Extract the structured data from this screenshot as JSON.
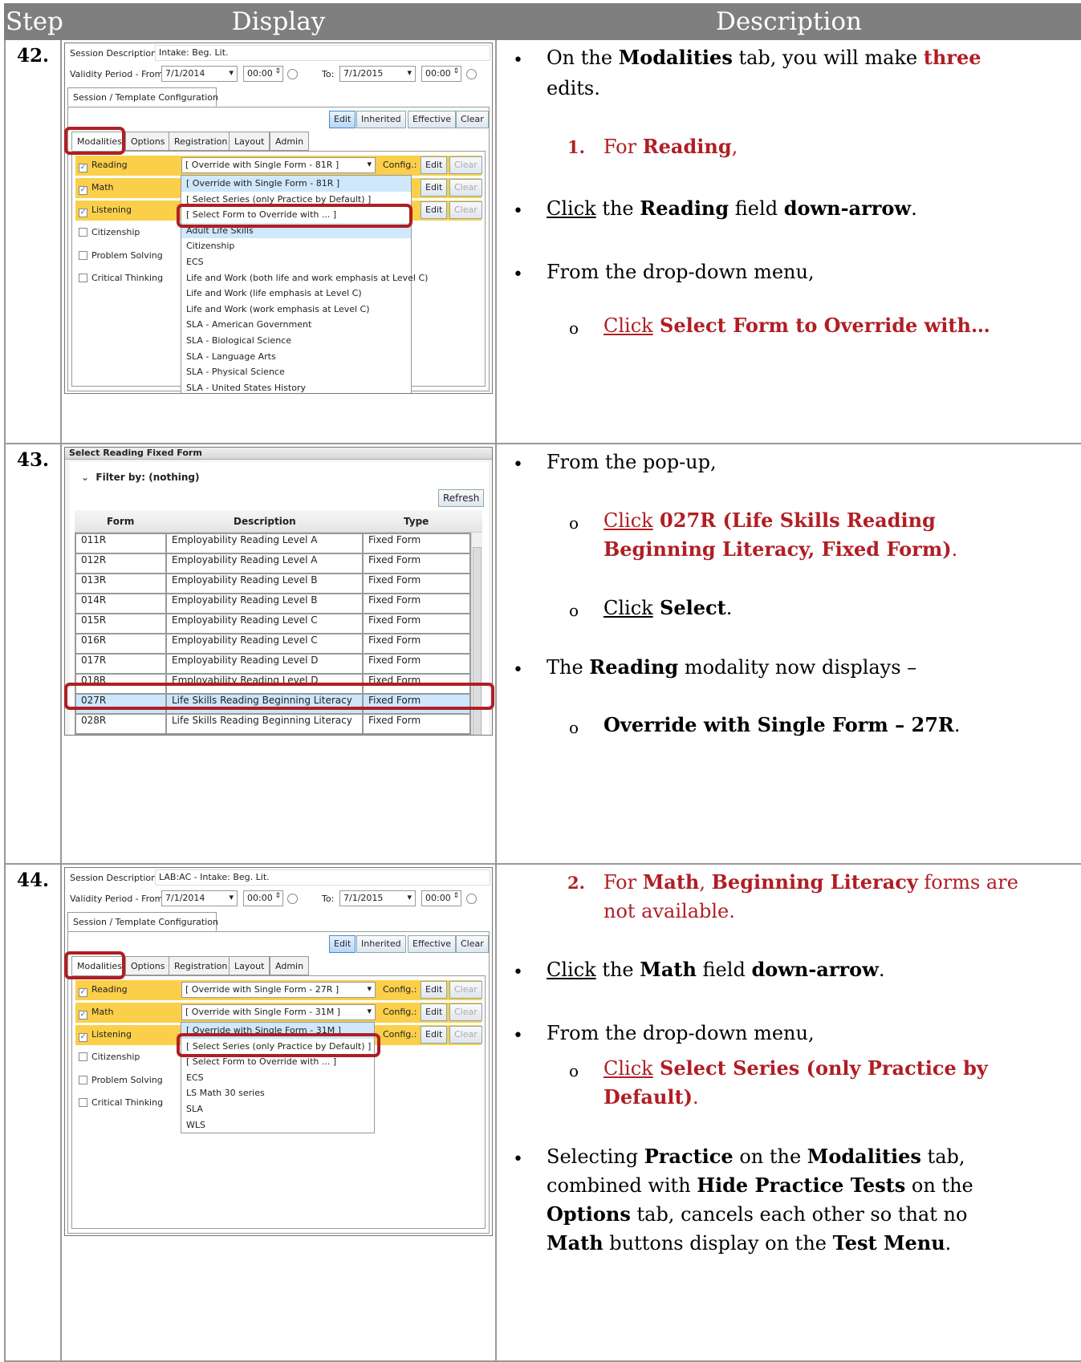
{
  "header": {
    "step": "Step",
    "display": "Display",
    "description": "Description"
  },
  "colors": {
    "accent_red": "#b01e24",
    "modality_yellow": "#fbcf4a",
    "header_gray": "#7f7f7f"
  },
  "rows": [
    {
      "step": "42.",
      "shot": {
        "session_label": "Session Description:",
        "session_value": "Intake: Beg. Lit.",
        "validity_from_label": "Validity Period - From:",
        "from_date": "7/1/2014",
        "from_time": "00:00",
        "to_label": "To:",
        "to_date": "7/1/2015",
        "to_time": "00:00",
        "config_tab": "Session / Template Configuration",
        "buttons": [
          "Edit",
          "Inherited",
          "Effective",
          "Clear"
        ],
        "tabs": [
          "Modalities",
          "Options",
          "Registration",
          "Layout",
          "Admin"
        ],
        "modalities": [
          {
            "label": "Reading",
            "checked": true,
            "select": "[ Override with Single Form - 81R ]"
          },
          {
            "label": "Math",
            "checked": true,
            "select": ""
          },
          {
            "label": "Listening",
            "checked": true,
            "select": ""
          },
          {
            "label": "Citizenship",
            "checked": false
          },
          {
            "label": "Problem Solving",
            "checked": false
          },
          {
            "label": "Critical Thinking",
            "checked": false
          }
        ],
        "config_label": "Config.:",
        "edit": "Edit",
        "clear": "Clear",
        "dropdown": [
          "[ Override with Single Form - 81R ]",
          "[ Select Series (only Practice by Default) ]",
          "[ Select Form to Override with ... ]",
          "Adult Life Skills",
          "Citizenship",
          "ECS",
          "Life and Work (both life and work emphasis at Level C)",
          "Life and Work (life emphasis at Level C)",
          "Life and Work (work emphasis at Level C)",
          "SLA - American Government",
          "SLA - Biological Science",
          "SLA - Language Arts",
          "SLA - Physical Science",
          "SLA - United States History"
        ]
      },
      "desc": {
        "l1a": "On the ",
        "l1b": "Modalities",
        "l1c": " tab, you will make ",
        "l1d": "three",
        "l2": "edits.",
        "num": "1.",
        "l3a": "For ",
        "l3b": "Reading",
        "l3c": ",",
        "l4a": "Click",
        "l4b": " the ",
        "l4c": "Reading",
        "l4d": " field ",
        "l4e": "down-arrow",
        "l4f": ".",
        "l5": "From the drop-down menu,",
        "sub": "o",
        "l6a": "Click",
        "l6b": " Select Form to Override with…"
      }
    },
    {
      "step": "43.",
      "shot": {
        "title": "Select Reading Fixed Form",
        "filter": "Filter by: (nothing)",
        "refresh": "Refresh",
        "columns": [
          "Form",
          "Description",
          "Type"
        ],
        "rows": [
          [
            "011R",
            "Employability Reading Level A",
            "Fixed Form"
          ],
          [
            "012R",
            "Employability Reading Level A",
            "Fixed Form"
          ],
          [
            "013R",
            "Employability Reading Level B",
            "Fixed Form"
          ],
          [
            "014R",
            "Employability Reading Level B",
            "Fixed Form"
          ],
          [
            "015R",
            "Employability Reading Level C",
            "Fixed Form"
          ],
          [
            "016R",
            "Employability Reading Level C",
            "Fixed Form"
          ],
          [
            "017R",
            "Employability Reading Level D",
            "Fixed Form"
          ],
          [
            "018R",
            "Employability Reading Level D",
            "Fixed Form"
          ],
          [
            "027R",
            "Life Skills Reading Beginning Literacy",
            "Fixed Form"
          ],
          [
            "028R",
            "Life Skills Reading Beginning Literacy",
            "Fixed Form"
          ]
        ]
      },
      "desc": {
        "l1": "From the pop-up,",
        "l2a": "Click",
        "l2b": " 027R (Life Skills Reading",
        "l3": "Beginning Literacy, Fixed Form)",
        "l3b": ".",
        "l4a": "Click",
        "l4b": " Select",
        "l4c": ".",
        "l5a": "The ",
        "l5b": "Reading",
        "l5c": " modality now displays –",
        "l6a": "Override with Single Form – 27R",
        "l6b": "."
      }
    },
    {
      "step": "44.",
      "shot": {
        "session_label": "Session Description:",
        "session_value": "LAB:AC - Intake: Beg. Lit.",
        "validity_from_label": "Validity Period - From:",
        "from_date": "7/1/2014",
        "from_time": "00:00",
        "to_label": "To:",
        "to_date": "7/1/2015",
        "to_time": "00:00",
        "config_tab": "Session / Template Configuration",
        "buttons": [
          "Edit",
          "Inherited",
          "Effective",
          "Clear"
        ],
        "tabs": [
          "Modalities",
          "Options",
          "Registration",
          "Layout",
          "Admin"
        ],
        "modalities": [
          {
            "label": "Reading",
            "checked": true,
            "select": "[ Override with Single Form - 27R ]"
          },
          {
            "label": "Math",
            "checked": true,
            "select": "[ Override with Single Form - 31M ]"
          },
          {
            "label": "Listening",
            "checked": true,
            "select": ""
          },
          {
            "label": "Citizenship",
            "checked": false
          },
          {
            "label": "Problem Solving",
            "checked": false
          },
          {
            "label": "Critical Thinking",
            "checked": false
          }
        ],
        "config_label": "Config.:",
        "edit": "Edit",
        "clear": "Clear",
        "dropdown": [
          "[ Override with Single Form - 31M ]",
          "[ Select Series (only Practice by Default) ]",
          "[ Select Form to Override with ... ]",
          "ECS",
          "LS Math 30 series",
          "SLA",
          "WLS"
        ]
      },
      "desc": {
        "num": "2.",
        "l1a": "For ",
        "l1b": "Math",
        "l1c": ", ",
        "l1d": "Beginning Literacy",
        "l1e": " forms are",
        "l2": "not available.",
        "l3a": "Click",
        "l3b": " the ",
        "l3c": "Math",
        "l3d": " field ",
        "l3e": "down-arrow",
        "l3f": ".",
        "l4": "From the drop-down menu,",
        "sub": "o",
        "l5a": "Click",
        "l5b": " Select Series (only Practice by",
        "l6": "Default)",
        "l6b": ".",
        "l7a": "Selecting ",
        "l7b": "Practice",
        "l7c": " on the ",
        "l7d": "Modalities",
        "l7e": " tab,",
        "l8a": "combined with ",
        "l8b": "Hide Practice Tests",
        "l8c": " on the",
        "l9a": "Options",
        "l9b": " tab, cancels each other so that no",
        "l10a": "Math",
        "l10b": " buttons display on the ",
        "l10c": "Test Menu",
        "l10d": "."
      }
    }
  ]
}
